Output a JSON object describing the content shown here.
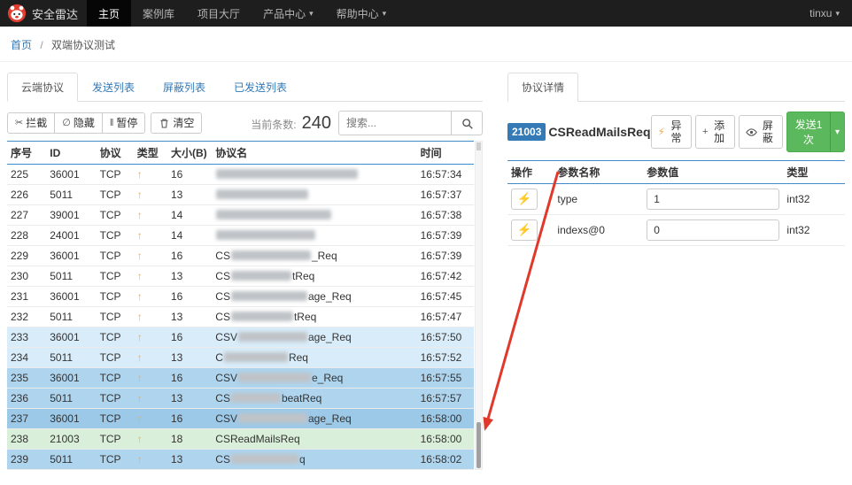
{
  "topbar": {
    "brand": "安全雷达",
    "nav": [
      {
        "label": "主页"
      },
      {
        "label": "案例库"
      },
      {
        "label": "项目大厅"
      },
      {
        "label": "产品中心"
      },
      {
        "label": "帮助中心"
      }
    ],
    "user": "tinxu"
  },
  "breadcrumb": {
    "home": "首页",
    "sep": "/",
    "current": "双端协议测试"
  },
  "left": {
    "tabs": [
      {
        "label": "云端协议"
      },
      {
        "label": "发送列表"
      },
      {
        "label": "屏蔽列表"
      },
      {
        "label": "已发送列表"
      }
    ],
    "toolbar": {
      "intercept": "拦截",
      "hide": "隐藏",
      "pause": "暂停",
      "clear": "清空",
      "count_label": "当前条数:",
      "count_value": "240",
      "search_placeholder": "搜索..."
    },
    "table": {
      "headers": [
        "序号",
        "ID",
        "协议",
        "类型",
        "大小(B)",
        "协议名",
        "时间"
      ],
      "rows": [
        {
          "no": "225",
          "id": "36001",
          "proto": "TCP",
          "size": "16",
          "time": "16:57:34",
          "hl": "",
          "name": {
            "pre": "",
            "blur": 160,
            "post": ""
          }
        },
        {
          "no": "226",
          "id": "5011",
          "proto": "TCP",
          "size": "13",
          "time": "16:57:37",
          "hl": "",
          "name": {
            "pre": "",
            "blur": 104,
            "post": ""
          }
        },
        {
          "no": "227",
          "id": "39001",
          "proto": "TCP",
          "size": "14",
          "time": "16:57:38",
          "hl": "",
          "name": {
            "pre": "",
            "blur": 130,
            "post": ""
          }
        },
        {
          "no": "228",
          "id": "24001",
          "proto": "TCP",
          "size": "14",
          "time": "16:57:39",
          "hl": "",
          "name": {
            "pre": "",
            "blur": 112,
            "post": ""
          }
        },
        {
          "no": "229",
          "id": "36001",
          "proto": "TCP",
          "size": "16",
          "time": "16:57:39",
          "hl": "",
          "name": {
            "pre": "CS",
            "blur": 90,
            "post": "_Req"
          }
        },
        {
          "no": "230",
          "id": "5011",
          "proto": "TCP",
          "size": "13",
          "time": "16:57:42",
          "hl": "",
          "name": {
            "pre": "CS",
            "blur": 68,
            "post": "tReq"
          }
        },
        {
          "no": "231",
          "id": "36001",
          "proto": "TCP",
          "size": "16",
          "time": "16:57:45",
          "hl": "",
          "name": {
            "pre": "CS",
            "blur": 86,
            "post": "age_Req"
          }
        },
        {
          "no": "232",
          "id": "5011",
          "proto": "TCP",
          "size": "13",
          "time": "16:57:47",
          "hl": "",
          "name": {
            "pre": "CS",
            "blur": 70,
            "post": "tReq"
          }
        },
        {
          "no": "233",
          "id": "36001",
          "proto": "TCP",
          "size": "16",
          "time": "16:57:50",
          "hl": "b1",
          "name": {
            "pre": "CSV",
            "blur": 78,
            "post": "age_Req"
          }
        },
        {
          "no": "234",
          "id": "5011",
          "proto": "TCP",
          "size": "13",
          "time": "16:57:52",
          "hl": "b1",
          "name": {
            "pre": "C",
            "blur": 72,
            "post": "Req"
          }
        },
        {
          "no": "235",
          "id": "36001",
          "proto": "TCP",
          "size": "16",
          "time": "16:57:55",
          "hl": "b2",
          "name": {
            "pre": "CSV",
            "blur": 82,
            "post": "e_Req"
          }
        },
        {
          "no": "236",
          "id": "5011",
          "proto": "TCP",
          "size": "13",
          "time": "16:57:57",
          "hl": "b2",
          "name": {
            "pre": "CS",
            "blur": 56,
            "post": "beatReq"
          }
        },
        {
          "no": "237",
          "id": "36001",
          "proto": "TCP",
          "size": "16",
          "time": "16:58:00",
          "hl": "b3",
          "name": {
            "pre": "CSV",
            "blur": 78,
            "post": "age_Req"
          }
        },
        {
          "no": "238",
          "id": "21003",
          "proto": "TCP",
          "size": "18",
          "time": "16:58:00",
          "hl": "g",
          "name": {
            "pre": "CSReadMailsReq",
            "blur": 0,
            "post": ""
          }
        },
        {
          "no": "239",
          "id": "5011",
          "proto": "TCP",
          "size": "13",
          "time": "16:58:02",
          "hl": "b2",
          "name": {
            "pre": "CS",
            "blur": 76,
            "post": "q"
          }
        }
      ]
    }
  },
  "right": {
    "tab": "协议详情",
    "badge": "21003",
    "title": "CSReadMailsReq",
    "actions": {
      "exception": "异常",
      "add": "添加",
      "block": "屏蔽",
      "send": "发送1次"
    },
    "table": {
      "headers": [
        "操作",
        "参数名称",
        "参数值",
        "类型"
      ],
      "rows": [
        {
          "param": "type",
          "value": "1",
          "type": "int32"
        },
        {
          "param": "indexs@0",
          "value": "0",
          "type": "int32"
        }
      ]
    }
  },
  "icons": {
    "up_arrow": "↑",
    "caret": "▾",
    "lightning": "⚡",
    "scissors": "✂",
    "hide_slash": "∅",
    "pause": "‖",
    "plus": "+"
  },
  "colors": {
    "topbar_bg": "#1e1e1e",
    "link_blue": "#337ab7",
    "table_border_blue": "#428bca",
    "row_highlight_light": "#d9ecf9",
    "row_highlight_medium": "#aed4ee",
    "row_highlight_dark": "#9dc9e8",
    "row_highlight_green": "#d9efd9",
    "send_button_green": "#5cb85c",
    "direction_arrow_orange": "#f0ad4e",
    "annotation_arrow_red": "#e0392b"
  }
}
